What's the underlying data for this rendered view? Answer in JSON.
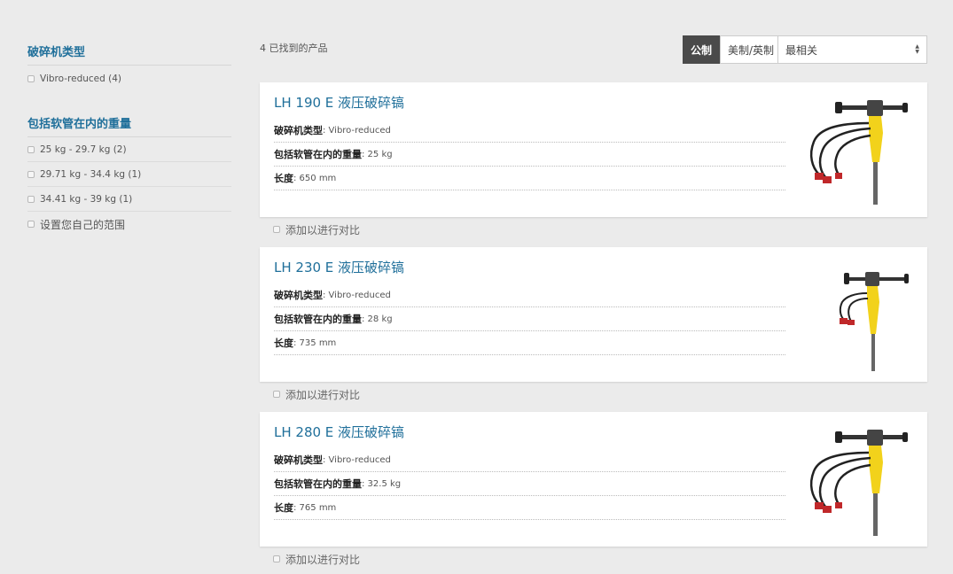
{
  "sidebar": {
    "groups": [
      {
        "title": "破碎机类型",
        "options": [
          {
            "label": "Vibro-reduced (4)"
          }
        ]
      },
      {
        "title": "包括软管在内的重量",
        "options": [
          {
            "label": "25 kg - 29.7 kg (2)"
          },
          {
            "label": "29.71 kg - 34.4 kg (1)"
          },
          {
            "label": "34.41 kg - 39 kg (1)"
          },
          {
            "label": "设置您自己的范围"
          }
        ]
      }
    ]
  },
  "toolbar": {
    "result_count": "4 已找到的产品",
    "unit_metric": "公制",
    "unit_imperial": "美制/英制",
    "sort_value": "最相关"
  },
  "products": [
    {
      "title": "LH 190 E 液压破碎镐",
      "specs": [
        {
          "label": "破碎机类型",
          "value": " : Vibro-reduced"
        },
        {
          "label": "包括软管在内的重量",
          "value": " : 25 kg"
        },
        {
          "label": "长度",
          "value": " : 650 mm"
        }
      ],
      "compare_label": "添加以进行对比"
    },
    {
      "title": "LH 230 E 液压破碎镐",
      "specs": [
        {
          "label": "破碎机类型",
          "value": " : Vibro-reduced"
        },
        {
          "label": "包括软管在内的重量",
          "value": " : 28 kg"
        },
        {
          "label": "长度",
          "value": " : 735 mm"
        }
      ],
      "compare_label": "添加以进行对比"
    },
    {
      "title": "LH 280 E 液压破碎镐",
      "specs": [
        {
          "label": "破碎机类型",
          "value": " : Vibro-reduced"
        },
        {
          "label": "包括软管在内的重量",
          "value": " : 32.5 kg"
        },
        {
          "label": "长度",
          "value": " : 765 mm"
        }
      ],
      "compare_label": "添加以进行对比"
    }
  ],
  "colors": {
    "accent": "#1f6f9a",
    "tool_yellow": "#f2d21b",
    "background": "#ebebeb"
  }
}
